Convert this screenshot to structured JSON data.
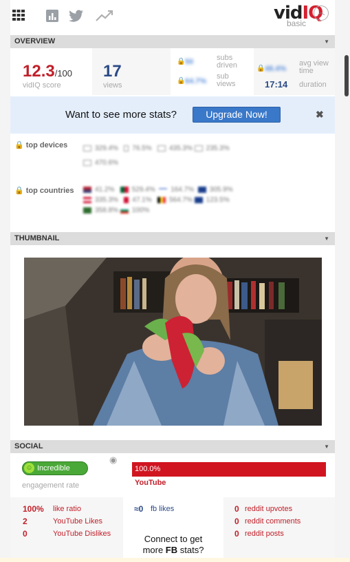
{
  "brand": {
    "name_part1": "vid",
    "name_part2": "IQ",
    "plan": "basic",
    "toggle_icon": "chevron-up-icon"
  },
  "toolbar": {
    "icons": [
      "grid-icon",
      "bar-chart-icon",
      "twitter-icon",
      "trending-icon"
    ]
  },
  "overview": {
    "title": "OVERVIEW",
    "score": {
      "value": "12.3",
      "max": "/100",
      "label": "vidIQ score"
    },
    "views": {
      "value": "17",
      "label": "views"
    },
    "subs": {
      "driven_value": "50",
      "driven_label": "subs driven",
      "sub_views_value": "64.7%",
      "sub_views_label": "sub views"
    },
    "watch": {
      "avg_value": "48.4%",
      "avg_label": "avg view time",
      "duration_value": "17:14",
      "duration_label": "duration"
    },
    "upgrade": {
      "text": "Want to see more stats?",
      "button": "Upgrade Now!",
      "close": "✖"
    },
    "devices": {
      "label": "top devices",
      "items": [
        "329.4%",
        "76.5%",
        "435.3%",
        "235.3%",
        "470.6%"
      ]
    },
    "countries": {
      "label": "top countries",
      "items": [
        "41.2%",
        "529.4%",
        "164.7%",
        "305.9%",
        "335.3%",
        "47.1%",
        "564.7%",
        "123.5%",
        "358.8%",
        "100%"
      ]
    }
  },
  "thumbnail": {
    "title": "THUMBNAIL"
  },
  "social": {
    "title": "SOCIAL",
    "engagement": {
      "badge": "Incredible",
      "label": "engagement rate"
    },
    "youtube_share": {
      "value": "100.0%",
      "name": "YouTube"
    },
    "youtube_stats": [
      {
        "value": "100%",
        "label": "like ratio"
      },
      {
        "value": "2",
        "label": "YouTube Likes"
      },
      {
        "value": "0",
        "label": "YouTube Dislikes"
      }
    ],
    "facebook": {
      "value": "≈0",
      "label": "fb likes",
      "connect_line1": "Connect to get",
      "connect_more": "more ",
      "connect_fb": "FB",
      "connect_end": " stats?"
    },
    "reddit_stats": [
      {
        "value": "0",
        "label": "reddit upvotes"
      },
      {
        "value": "0",
        "label": "reddit comments"
      },
      {
        "value": "0",
        "label": "reddit posts"
      }
    ]
  },
  "colors": {
    "accent_red": "#c0202a",
    "accent_blue": "#2b4a86",
    "upgrade_button": "#3a78c9",
    "youtube_red": "#d01520",
    "engagement_green": "#4aa838"
  }
}
